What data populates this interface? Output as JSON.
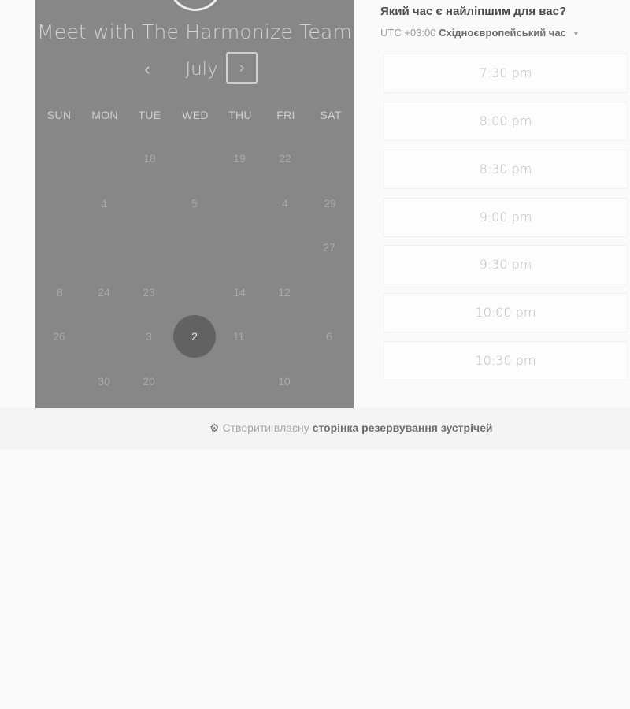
{
  "calendar": {
    "title": "Meet with The Harmonize Team",
    "month": "July",
    "prev_symbol": "‹",
    "next_symbol": "›",
    "weekdays": [
      "SUN",
      "MON",
      "TUE",
      "WED",
      "THU",
      "FRI",
      "SAT"
    ],
    "days": [
      {
        "label": "18"
      },
      {
        "label": "19"
      },
      {
        "label": "22"
      },
      {
        "label": "1"
      },
      {
        "label": "5"
      },
      {
        "label": "4"
      },
      {
        "label": "29"
      },
      {
        "label": "27"
      },
      {
        "label": "8"
      },
      {
        "label": "24"
      },
      {
        "label": "23"
      },
      {
        "label": "14"
      },
      {
        "label": "12"
      },
      {
        "label": "26"
      },
      {
        "label": "3"
      },
      {
        "label": "2"
      },
      {
        "label": "11"
      },
      {
        "label": "6"
      },
      {
        "label": "30"
      },
      {
        "label": "20"
      },
      {
        "label": "10"
      }
    ],
    "selected_day": "2"
  },
  "times": {
    "question": "Який час є найліпшим для вас?",
    "tz_offset": "UTC +03:00",
    "tz_name": "Східноєвропейський час",
    "tz_caret": "▼",
    "slots": [
      "7:30 pm",
      "8:00 pm",
      "8:30 pm",
      "9:00 pm",
      "9:30 pm",
      "10:00 pm",
      "10:30 pm"
    ]
  },
  "footer": {
    "icon": "sprocket-icon",
    "text_light": "Створити власну",
    "text_bold": "сторінка резервування зустрічей"
  },
  "colors": {
    "panel": "#878787",
    "selected_day": "#626262",
    "page_bg": "#fafafa"
  }
}
